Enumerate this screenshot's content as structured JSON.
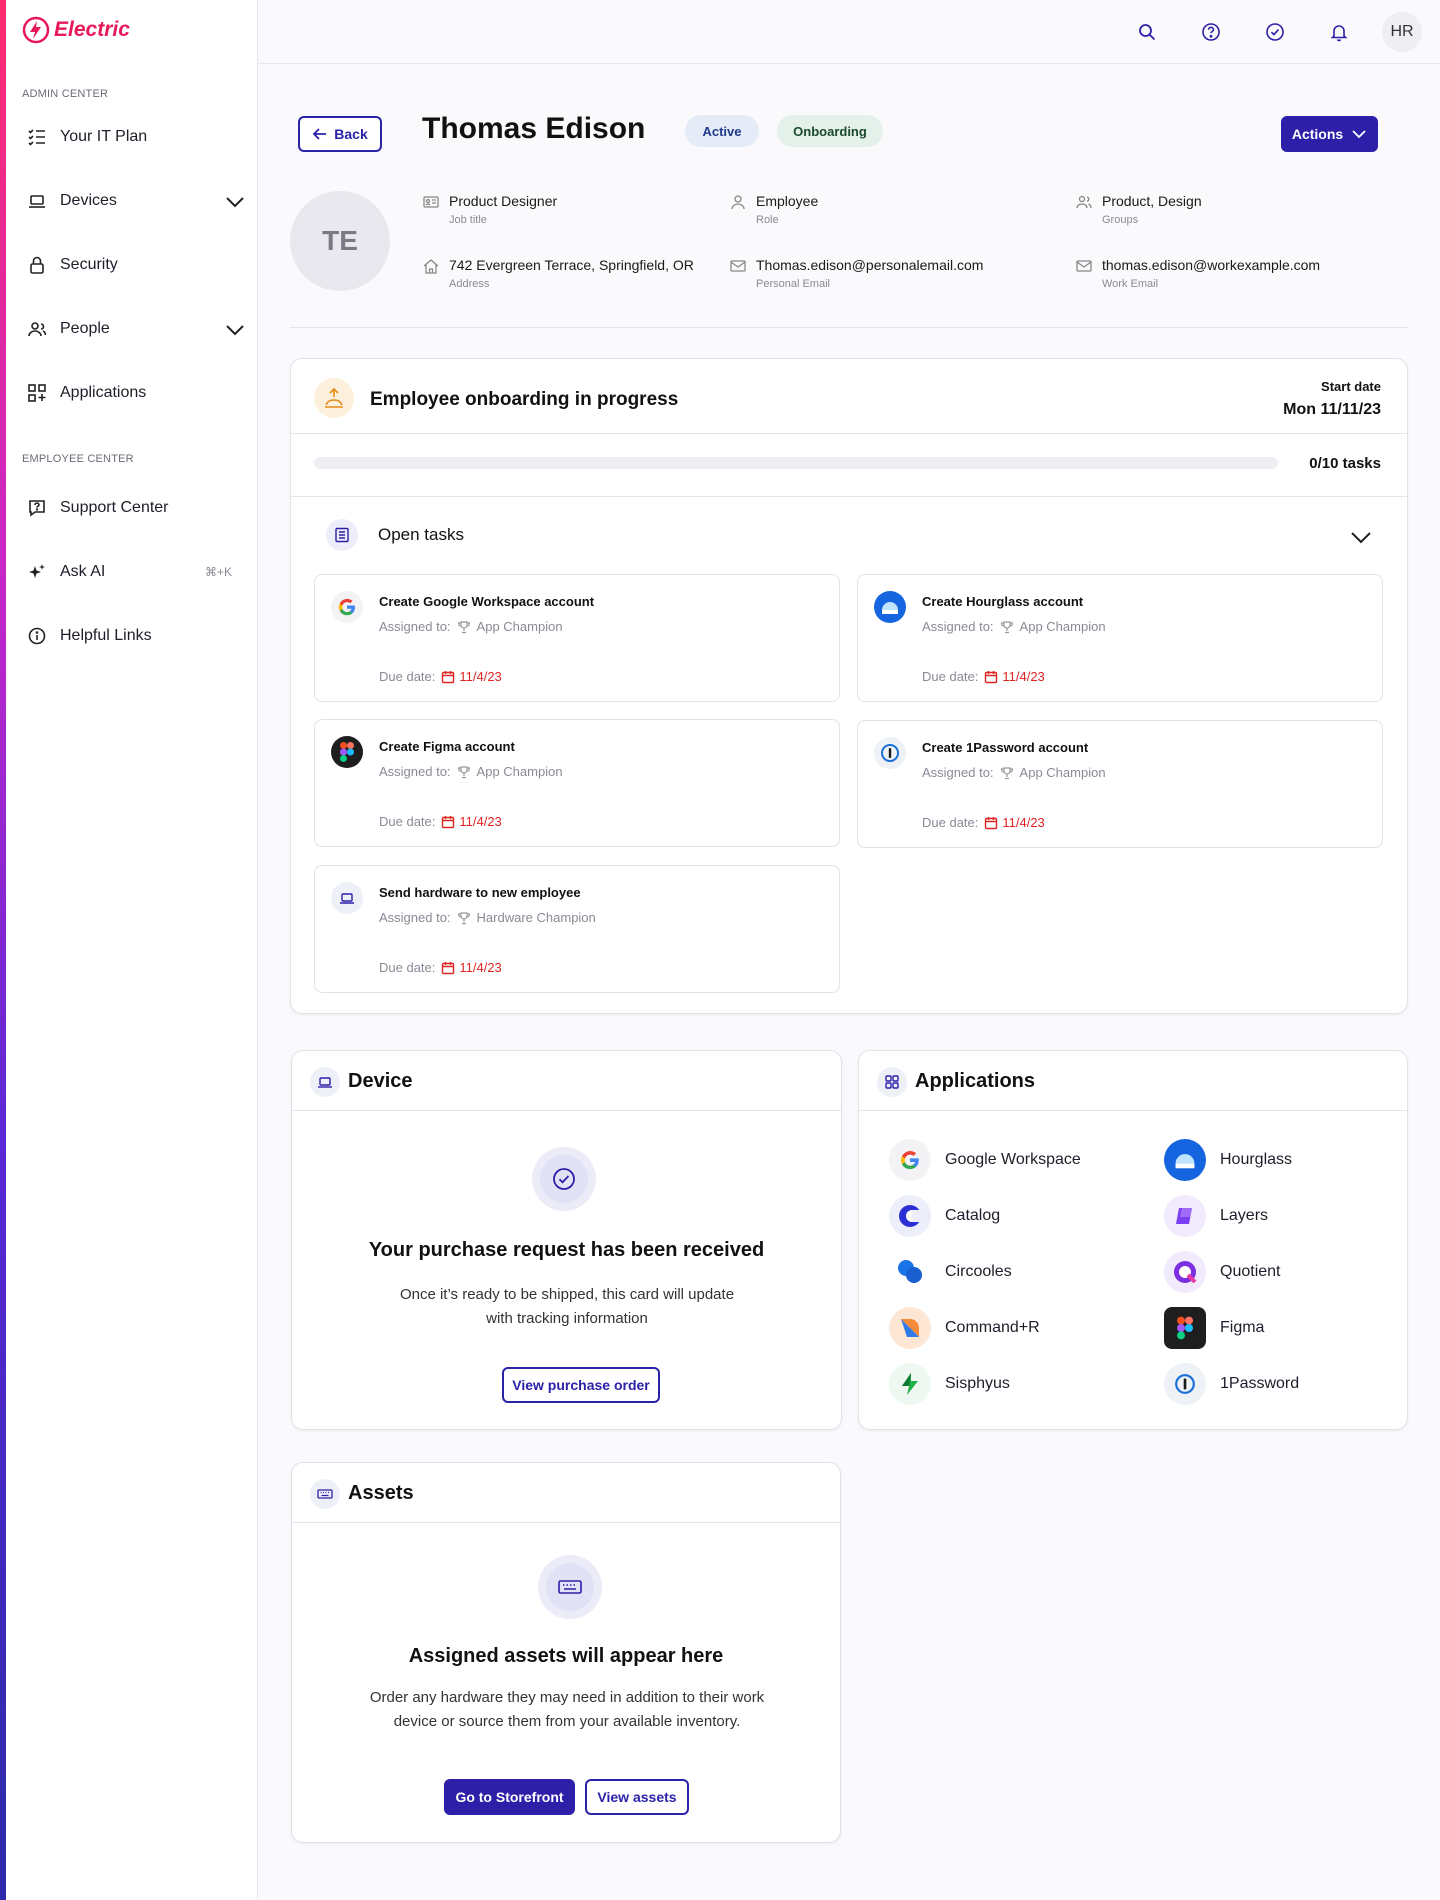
{
  "brand": {
    "name": "Electric"
  },
  "sidebar": {
    "admin_label": "ADMIN CENTER",
    "employee_label": "EMPLOYEE CENTER",
    "items": [
      {
        "label": "Your IT Plan",
        "icon": "checklist-icon"
      },
      {
        "label": "Devices",
        "icon": "laptop-icon"
      },
      {
        "label": "Security",
        "icon": "lock-icon"
      },
      {
        "label": "People",
        "icon": "people-icon"
      },
      {
        "label": "Applications",
        "icon": "apps-grid-icon"
      },
      {
        "label": "Support Center",
        "icon": "support-icon"
      },
      {
        "label": "Ask AI",
        "icon": "sparkle-icon",
        "shortcut": "⌘+K"
      },
      {
        "label": "Helpful Links",
        "icon": "info-icon"
      }
    ]
  },
  "topbar": {
    "avatar": "HR",
    "icons": [
      "search-icon",
      "help-icon",
      "check-circle-icon",
      "bell-icon"
    ]
  },
  "header": {
    "back_label": "Back",
    "name": "Thomas Edison",
    "status_active": "Active",
    "status_onboarding": "Onboarding",
    "actions_label": "Actions",
    "initials": "TE"
  },
  "profile": {
    "job_title": {
      "value": "Product Designer",
      "label": "Job title"
    },
    "role": {
      "value": "Employee",
      "label": "Role"
    },
    "groups": {
      "value": "Product, Design",
      "label": "Groups"
    },
    "address": {
      "value": "742 Evergreen Terrace, Springfield, OR",
      "label": "Address"
    },
    "personal_email": {
      "value": "Thomas.edison@personalemail.com",
      "label": "Personal Email"
    },
    "work_email": {
      "value": "thomas.edison@workexample.com",
      "label": "Work Email"
    }
  },
  "onboarding": {
    "title": "Employee onboarding in progress",
    "start_label": "Start date",
    "start_value": "Mon 11/11/23",
    "progress": 0,
    "tasks_count": "0/10 tasks",
    "open_tasks_label": "Open tasks",
    "assigned_label": "Assigned to:",
    "due_label": "Due date:",
    "tasks": [
      {
        "title": "Create Google Workspace account",
        "assignee": "App Champion",
        "due": "11/4/23"
      },
      {
        "title": "Create Hourglass account",
        "assignee": "App Champion",
        "due": "11/4/23"
      },
      {
        "title": "Create Figma account",
        "assignee": "App Champion",
        "due": "11/4/23"
      },
      {
        "title": "Create 1Password account",
        "assignee": "App Champion",
        "due": "11/4/23"
      },
      {
        "title": "Send hardware to new employee",
        "assignee": "Hardware Champion",
        "due": "11/4/23"
      }
    ]
  },
  "device": {
    "title": "Device",
    "empty_title": "Your purchase request has been received",
    "empty_line1": "Once it’s ready to be shipped, this card will update",
    "empty_line2": "with  tracking information",
    "button": "View purchase order"
  },
  "applications": {
    "title": "Applications",
    "items": [
      "Google Workspace",
      "Hourglass",
      "Catalog",
      "Layers",
      "Circooles",
      "Quotient",
      "Command+R",
      "Figma",
      "Sisphyus",
      "1Password"
    ]
  },
  "assets": {
    "title": "Assets",
    "empty_title": "Assigned assets will appear here",
    "empty_line1": "Order any hardware they may need in addition to their work",
    "empty_line2": "device or source them from your available inventory.",
    "primary_button": "Go to Storefront",
    "secondary_button": "View assets"
  },
  "colors": {
    "accent": "#2d1fa8",
    "brand": "#e8195a",
    "due": "#e02424"
  }
}
